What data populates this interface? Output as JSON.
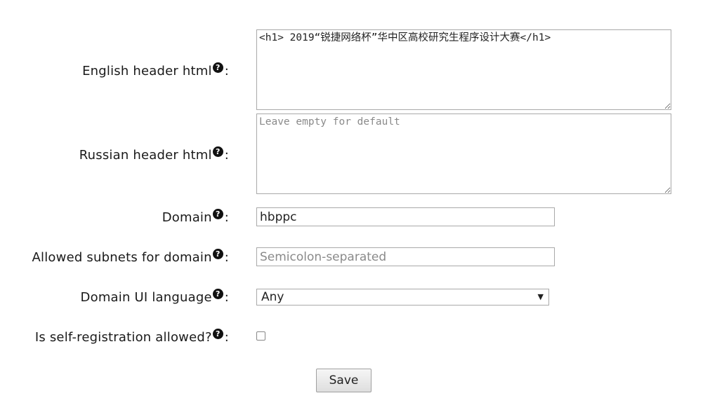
{
  "form": {
    "english_header": {
      "label": "English header html",
      "value": "<h1> 2019“锐捷网络杯”华中区高校研究生程序设计大赛</h1>"
    },
    "russian_header": {
      "label": "Russian header html",
      "placeholder": "Leave empty for default"
    },
    "domain": {
      "label": "Domain",
      "value": "hbppc"
    },
    "allowed_subnets": {
      "label": "Allowed subnets for domain",
      "placeholder": "Semicolon-separated"
    },
    "ui_language": {
      "label": "Domain UI language",
      "selected": "Any"
    },
    "self_registration": {
      "label": "Is self-registration allowed?",
      "checked": false
    },
    "help_glyph": "?",
    "colon": ":",
    "save_label": "Save"
  },
  "icons": [
    "question-circle-icon",
    "chevron-down-icon"
  ]
}
